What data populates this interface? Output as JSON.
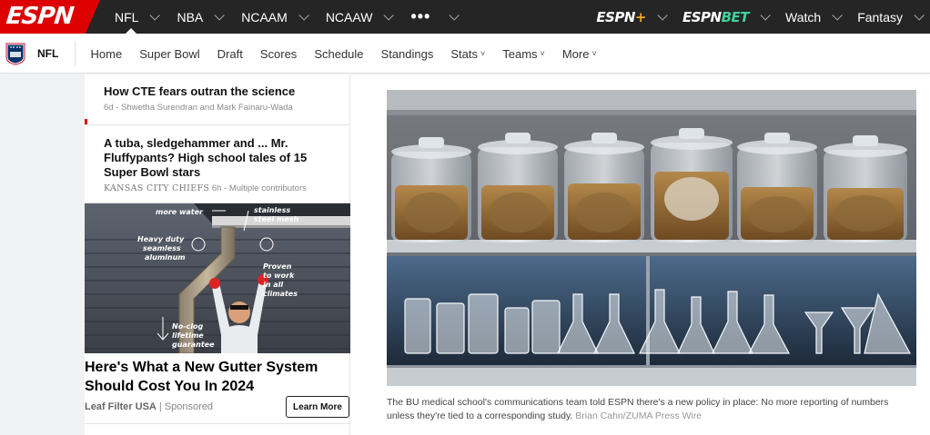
{
  "topbar": {
    "logo": "ESPN",
    "leagues": [
      {
        "label": "NFL",
        "active": true
      },
      {
        "label": "NBA"
      },
      {
        "label": "NCAAM"
      },
      {
        "label": "NCAAW"
      }
    ],
    "more_label": "•••",
    "espn_plus": {
      "text": "ESPN",
      "plus": "+"
    },
    "espn_bet": {
      "text": "ESPN",
      "bet": "BET"
    },
    "watch_label": "Watch",
    "fantasy_label": "Fantasy"
  },
  "subnav": {
    "league_label": "NFL",
    "items": [
      "Home",
      "Super Bowl",
      "Draft",
      "Scores",
      "Schedule",
      "Standings",
      "Stats",
      "Teams",
      "More"
    ],
    "caret": "˅"
  },
  "stories": [
    {
      "title": "How CTE fears outran the science",
      "age": "6d",
      "byline": "Shwetha Surendran and Mark Fainaru-Wada"
    },
    {
      "title": "A tuba, sledgehammer and ... Mr. Fluffypants? High school tales of 15 Super Bowl stars",
      "team": "KANSAS CITY CHIEFS",
      "age": "6h",
      "byline": "Multiple contributors"
    }
  ],
  "ad": {
    "image_callouts": {
      "water": "more water",
      "mesh": "stainless steel mesh",
      "aluminum": "Heavy duty seamless aluminum",
      "proven": "Proven to work in all climates",
      "guarantee": "No-clog lifetime guarantee"
    },
    "headline": "Here's What a New Gutter System Should Cost You In 2024",
    "advertiser": "Leaf Filter USA",
    "sponsored": "Sponsored",
    "cta": "Learn More"
  },
  "main": {
    "caption": "The BU medical school's communications team told ESPN there's a new policy in place: No more reporting of numbers unless they're tied to a corresponding study.",
    "credit": "Brian Cahn/ZUMA Press Wire"
  },
  "colors": {
    "topbar": "#252525",
    "espn_red": "#dd0000",
    "espn_plus_accent": "#f5a623",
    "espn_bet_accent": "#3fd19c",
    "page_gutter": "#f1f2f3"
  }
}
